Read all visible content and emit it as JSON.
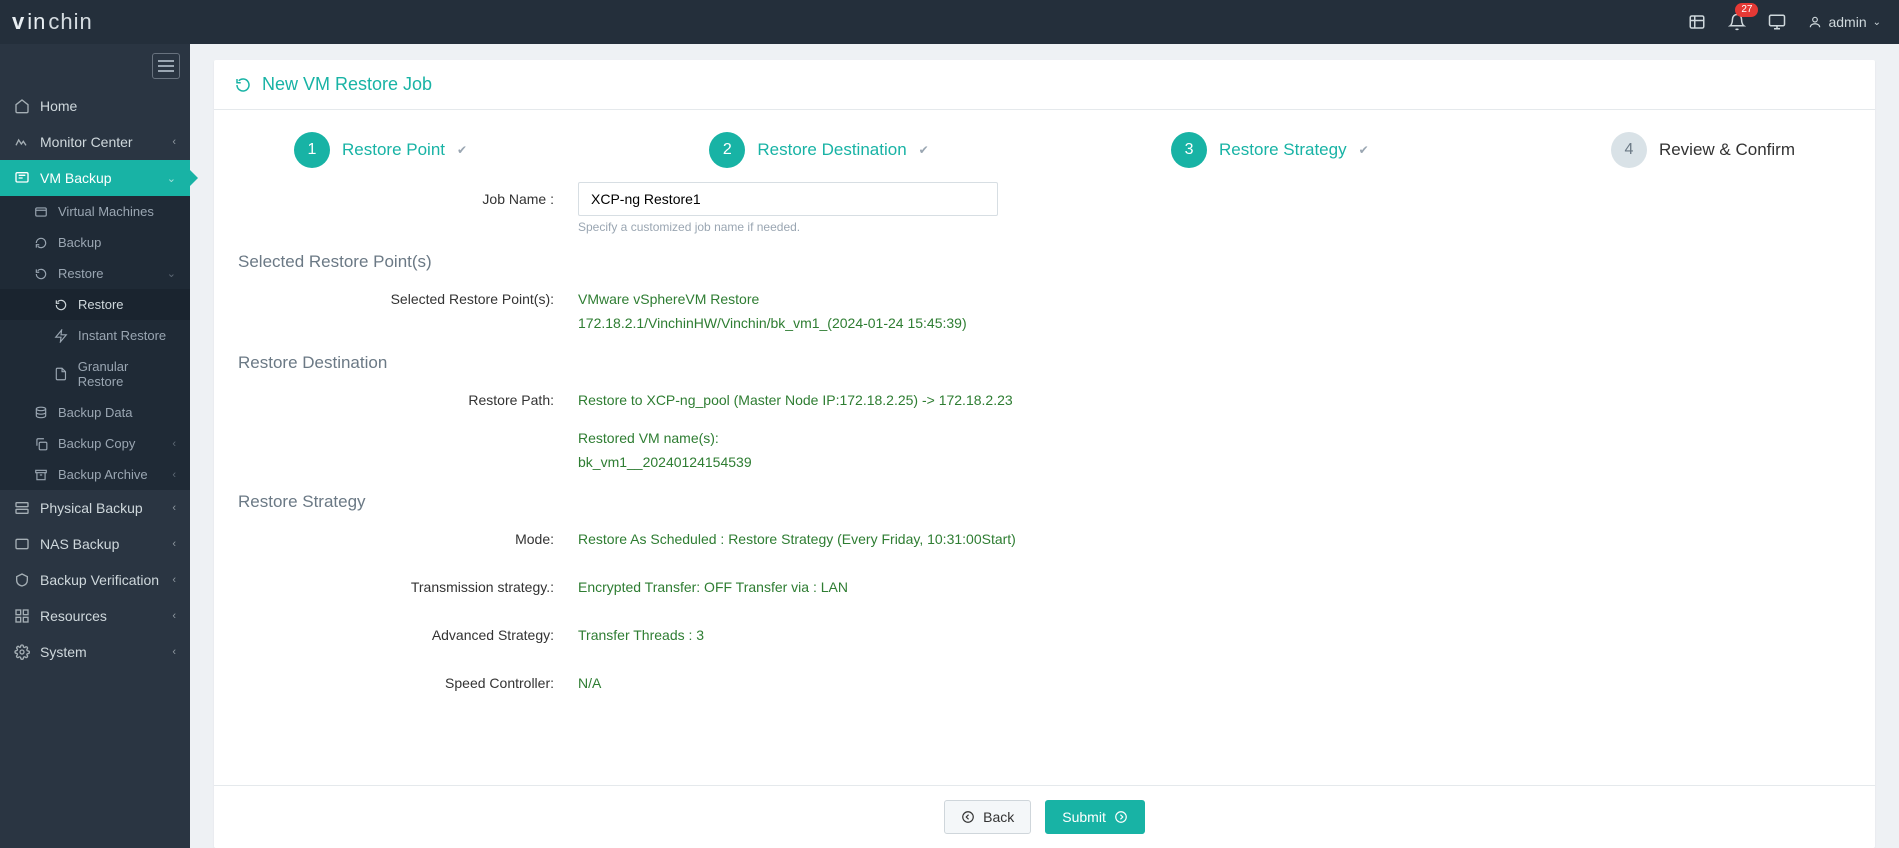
{
  "topbar": {
    "brand": {
      "vin": "vin",
      "chin": "chin"
    },
    "badge_count": "27",
    "user_label": "admin"
  },
  "sidebar": {
    "home": "Home",
    "monitor": "Monitor Center",
    "vmbackup": "VM Backup",
    "virtual_machines": "Virtual Machines",
    "backup": "Backup",
    "restore": "Restore",
    "restore_sub": "Restore",
    "instant_restore": "Instant Restore",
    "granular_restore": "Granular Restore",
    "backup_data": "Backup Data",
    "backup_copy": "Backup Copy",
    "backup_archive": "Backup Archive",
    "physical_backup": "Physical Backup",
    "nas_backup": "NAS Backup",
    "backup_verification": "Backup Verification",
    "resources": "Resources",
    "system": "System"
  },
  "panel": {
    "title": "New VM Restore Job"
  },
  "wizard": {
    "step1": "Restore Point",
    "step2": "Restore Destination",
    "step3": "Restore Strategy",
    "step4": "Review & Confirm",
    "n1": "1",
    "n2": "2",
    "n3": "3",
    "n4": "4"
  },
  "form": {
    "job_name_label": "Job Name :",
    "job_name_value": "XCP-ng Restore1",
    "job_name_hint": "Specify a customized job name if needed."
  },
  "sections": {
    "selected_points": "Selected Restore Point(s)",
    "restore_destination": "Restore Destination",
    "restore_strategy": "Restore Strategy"
  },
  "review": {
    "selected_points_label": "Selected Restore Point(s):",
    "selected_points_val1": "VMware vSphereVM Restore",
    "selected_points_val2": "172.18.2.1/VinchinHW/Vinchin/bk_vm1_(2024-01-24 15:45:39)",
    "restore_path_label": "Restore Path:",
    "restore_path_val": "Restore to XCP-ng_pool (Master Node IP:172.18.2.25) -> 172.18.2.23",
    "restored_vm_names_label": "Restored VM name(s):",
    "restored_vm_names_val": "bk_vm1__20240124154539",
    "mode_label": "Mode:",
    "mode_val": "Restore As Scheduled : Restore Strategy (Every Friday, 10:31:00Start)",
    "transmission_label": "Transmission strategy.:",
    "transmission_val": "Encrypted Transfer: OFF Transfer via : LAN",
    "advanced_label": "Advanced Strategy:",
    "advanced_val": "Transfer Threads : 3",
    "speed_label": "Speed Controller:",
    "speed_val": "N/A"
  },
  "footer": {
    "back": "Back",
    "submit": "Submit"
  }
}
